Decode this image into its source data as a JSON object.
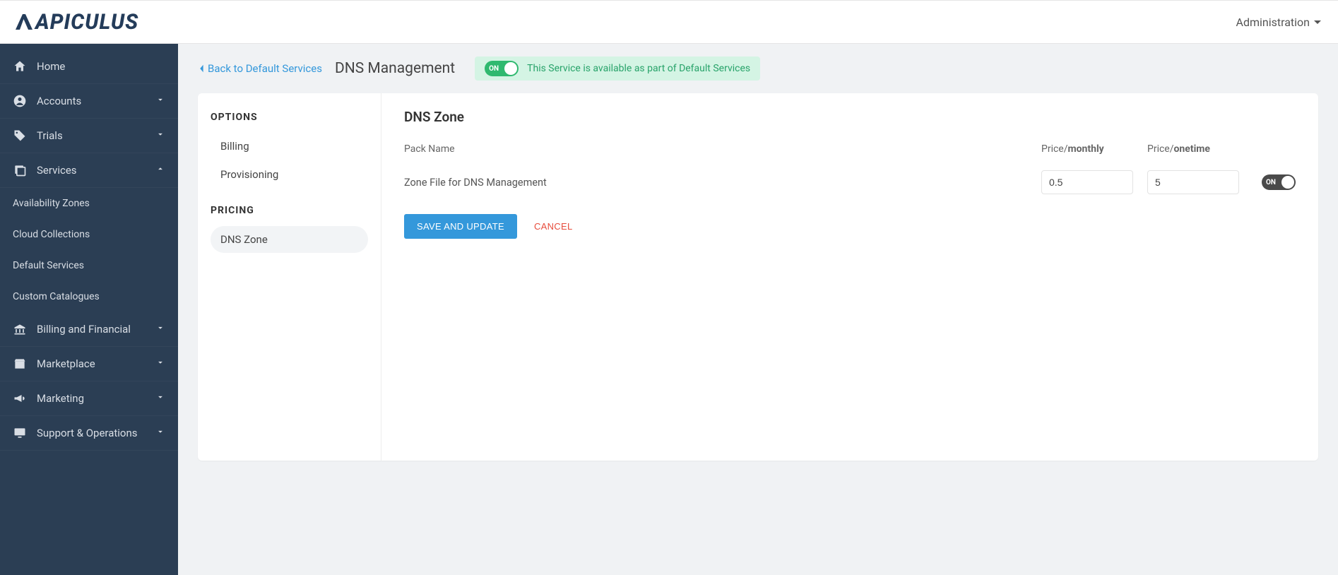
{
  "brand": "APICULUS",
  "topnav": {
    "admin_label": "Administration"
  },
  "sidebar": {
    "items": [
      {
        "label": "Home",
        "icon": "home"
      },
      {
        "label": "Accounts",
        "icon": "person",
        "expandable": true
      },
      {
        "label": "Trials",
        "icon": "tags",
        "expandable": true
      },
      {
        "label": "Services",
        "icon": "layers",
        "expandable": true,
        "expanded": true,
        "children": [
          {
            "label": "Availability Zones"
          },
          {
            "label": "Cloud Collections"
          },
          {
            "label": "Default Services"
          },
          {
            "label": "Custom Catalogues"
          }
        ]
      },
      {
        "label": "Billing and Financial",
        "icon": "bank",
        "expandable": true
      },
      {
        "label": "Marketplace",
        "icon": "store",
        "expandable": true
      },
      {
        "label": "Marketing",
        "icon": "bullhorn",
        "expandable": true
      },
      {
        "label": "Support & Operations",
        "icon": "monitor",
        "expandable": true
      }
    ]
  },
  "header": {
    "back_label": "Back to Default Services",
    "title": "DNS Management",
    "toggle_label": "ON",
    "status_text": "This Service is available as part of Default Services"
  },
  "options": {
    "section_label": "OPTIONS",
    "items": [
      {
        "label": "Billing"
      },
      {
        "label": "Provisioning"
      }
    ]
  },
  "pricing": {
    "section_label": "PRICING",
    "items": [
      {
        "label": "DNS Zone",
        "active": true
      }
    ]
  },
  "panel": {
    "title": "DNS Zone",
    "columns": {
      "name": "Pack Name",
      "monthly_prefix": "Price/",
      "monthly_bold": "monthly",
      "onetime_prefix": "Price/",
      "onetime_bold": "onetime"
    },
    "row": {
      "name": "Zone File for DNS Management",
      "monthly": "0.5",
      "onetime": "5",
      "toggle_label": "ON"
    },
    "actions": {
      "save": "SAVE AND UPDATE",
      "cancel": "CANCEL"
    }
  }
}
